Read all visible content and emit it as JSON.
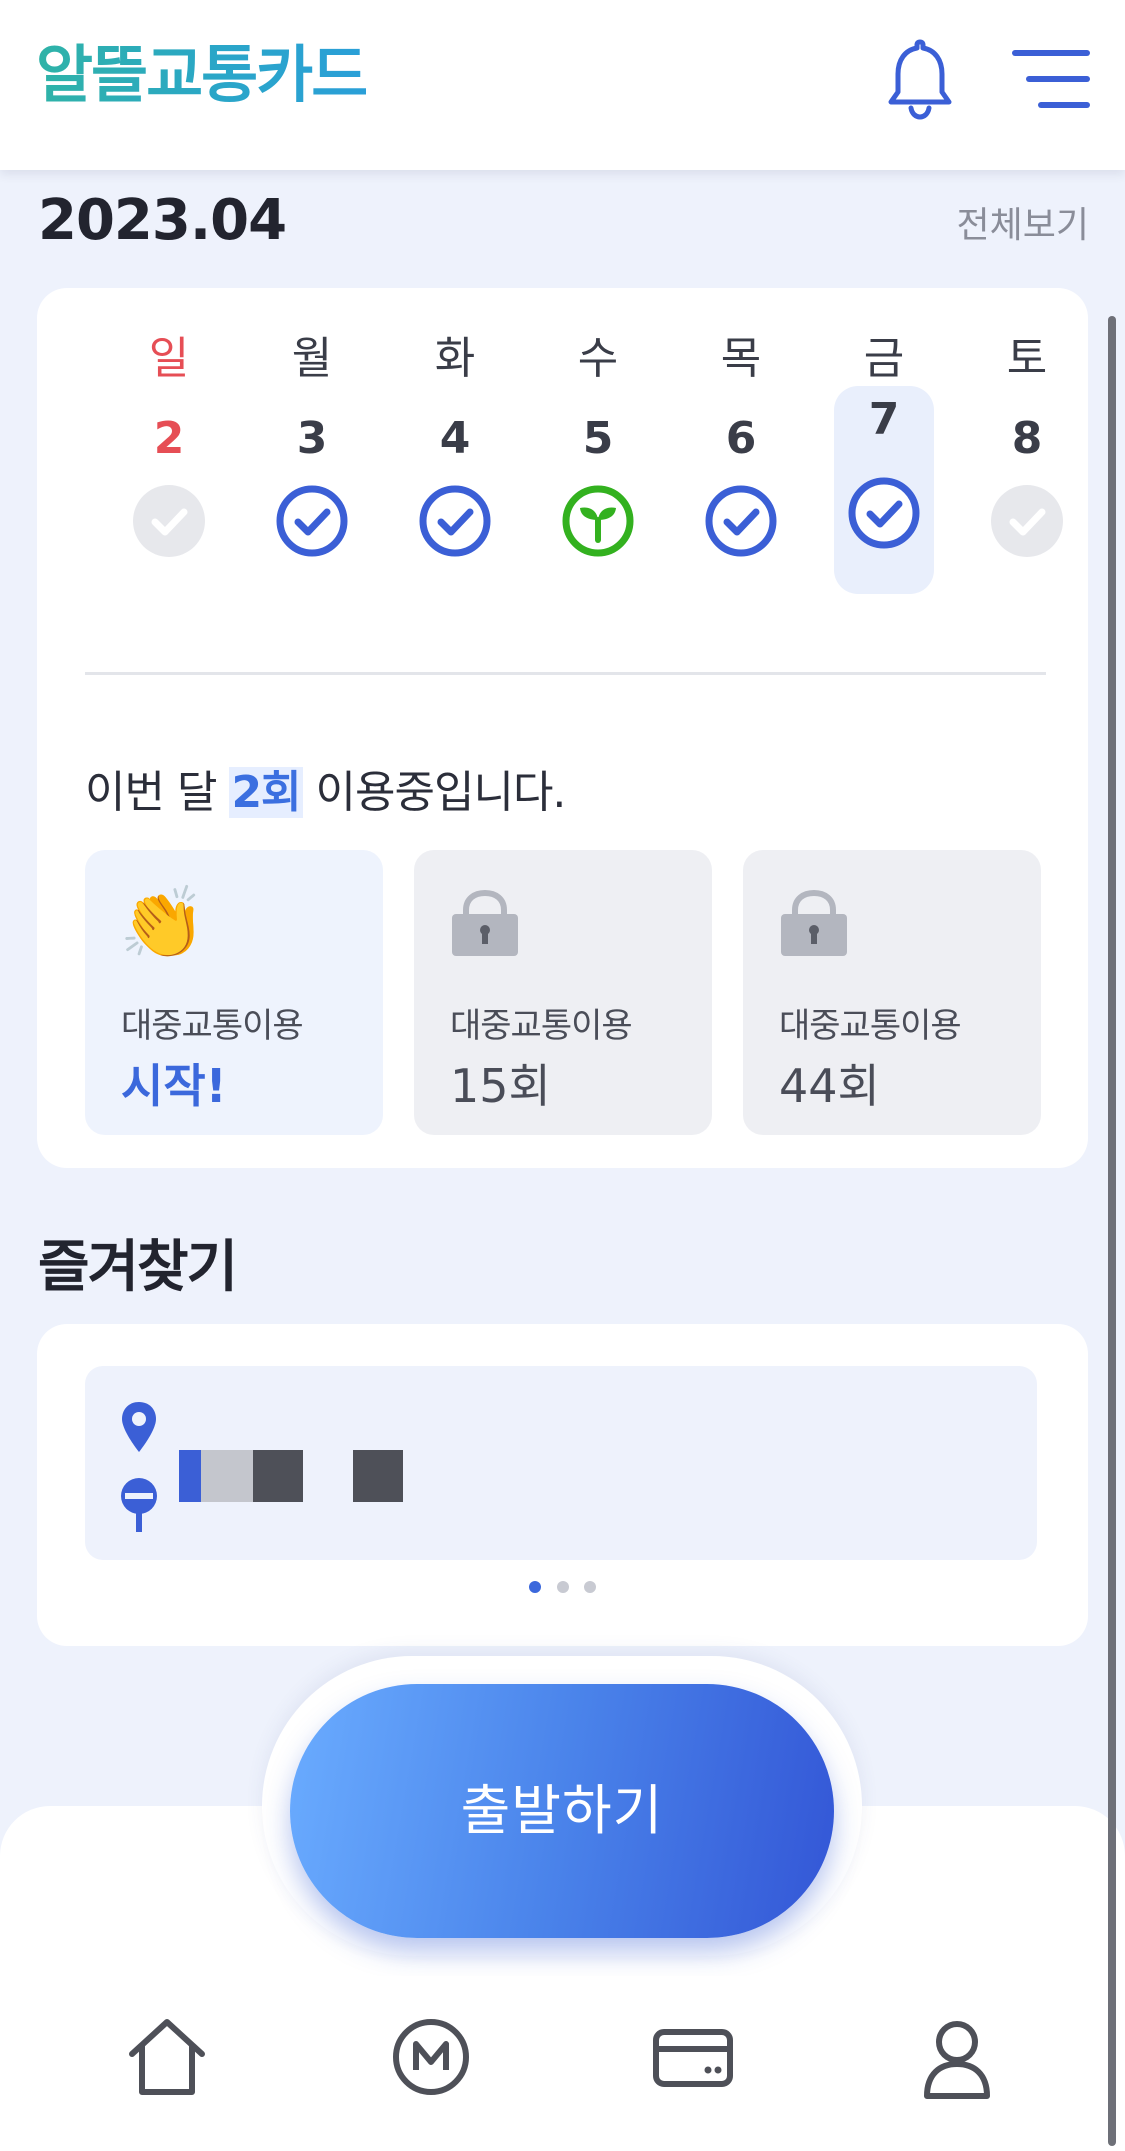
{
  "header": {
    "logo_text": "알뜰교통카드",
    "bell_icon": "bell-icon",
    "menu_icon": "hamburger-menu-icon"
  },
  "month": {
    "title": "2023.04",
    "view_all": "전체보기"
  },
  "calendar": {
    "days": [
      {
        "dow": "일",
        "date": "2",
        "status": "inactive"
      },
      {
        "dow": "월",
        "date": "3",
        "status": "checked"
      },
      {
        "dow": "화",
        "date": "4",
        "status": "checked"
      },
      {
        "dow": "수",
        "date": "5",
        "status": "sprout"
      },
      {
        "dow": "목",
        "date": "6",
        "status": "checked"
      },
      {
        "dow": "금",
        "date": "7",
        "status": "checked",
        "today": true
      },
      {
        "dow": "토",
        "date": "8",
        "status": "inactive"
      }
    ]
  },
  "usage": {
    "prefix": "이번 달",
    "count": "2회",
    "suffix": "이용중입니다."
  },
  "badges": [
    {
      "label": "대중교통이용",
      "value": "시작!",
      "icon": "clapping-hands-icon",
      "active": true
    },
    {
      "label": "대중교통이용",
      "value": "15회",
      "icon": "lock-icon",
      "active": false
    },
    {
      "label": "대중교통이용",
      "value": "44회",
      "icon": "lock-icon",
      "active": false
    }
  ],
  "favorites": {
    "title": "즐겨찾기",
    "page_indicator": {
      "current": 1,
      "total": 3
    }
  },
  "start_button": {
    "label": "출발하기"
  },
  "tab_bar": {
    "items": [
      {
        "icon": "home-icon"
      },
      {
        "icon": "metro-m-icon"
      },
      {
        "icon": "card-icon"
      },
      {
        "icon": "profile-icon"
      }
    ]
  },
  "colors": {
    "accent": "#3b68dc",
    "sunday": "#e64e55",
    "sprout": "#33b11f",
    "background": "#eef2fc"
  }
}
